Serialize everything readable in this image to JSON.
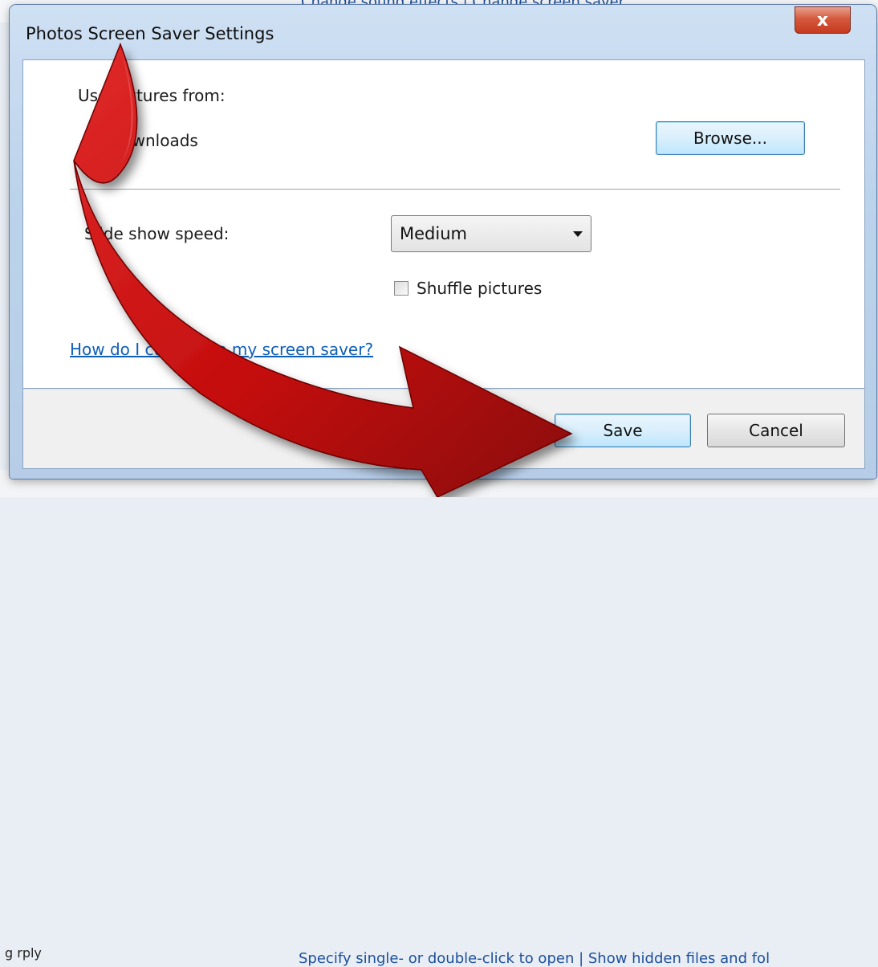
{
  "background": {
    "top_text": "Change sound effects    |    Change screen saver",
    "bottom_left": "g  rply",
    "bottom_text": "Specify single- or double-click to open    |    Show hidden files and fol"
  },
  "dialog": {
    "title": "Photos Screen Saver Settings",
    "close_label": "x",
    "use_pictures_label": "Use pictures from:",
    "folder_name": "Downloads",
    "browse_label": "Browse...",
    "slideshow_speed_label": "Slide show speed:",
    "speed_selected": "Medium",
    "shuffle_label": "Shuffle pictures",
    "shuffle_checked": false,
    "help_link": "How do I customize my screen saver?",
    "save_label": "Save",
    "cancel_label": "Cancel"
  },
  "colors": {
    "arrow": "#c40d0d",
    "link": "#0f5fb8",
    "focus_button": "#bee6fd"
  }
}
